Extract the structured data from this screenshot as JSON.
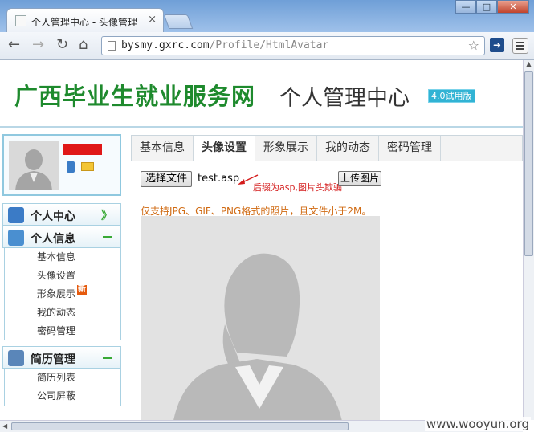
{
  "browser": {
    "tab_title": "个人管理中心 - 头像管理",
    "tab_close": "×",
    "window_buttons": [
      "—",
      "□",
      "✕"
    ],
    "url_host": "bysmy.gxrc.com",
    "url_path": "/Profile/HtmlAvatar",
    "icons": [
      "back-icon",
      "forward-icon",
      "reload-icon",
      "home-icon",
      "star-icon",
      "extension-icon",
      "menu-icon"
    ]
  },
  "header": {
    "site_name": "广西毕业生就业服务网",
    "center_name": "个人管理中心",
    "version_badge": "4.0试用版"
  },
  "sidebar": {
    "groups": [
      {
        "label": "个人中心",
        "icon": "home-icon",
        "indicator": "》"
      },
      {
        "label": "个人信息",
        "icon": "user-card-icon",
        "items": [
          "基本信息",
          "头像设置",
          "形象展示",
          "我的动态",
          "密码管理"
        ]
      },
      {
        "label": "简历管理",
        "icon": "resume-icon",
        "items": [
          "简历列表",
          "公司屏蔽"
        ]
      }
    ],
    "new_badge": "新"
  },
  "content": {
    "tabs": [
      "基本信息",
      "头像设置",
      "形象展示",
      "我的动态",
      "密码管理"
    ],
    "active_tab": "头像设置",
    "choose_file_label": "选择文件",
    "file_name": "test.asp",
    "upload_label": "上传图片",
    "annotation": "后缀为asp,图片头欺骗",
    "notice": "仅支持JPG、GIF、PNG格式的照片，且文件小于2M。"
  },
  "watermark": "www.wooyun.org",
  "colors": {
    "site_green": "#1e8a2d",
    "badge_cyan": "#31b3d4",
    "notice_orange": "#d06a12",
    "annotation_red": "#d41b1b",
    "border_blue": "#8fc8df"
  }
}
